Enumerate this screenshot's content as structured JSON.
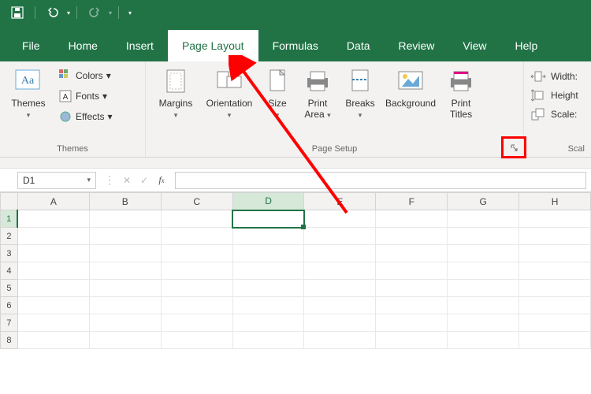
{
  "qat": {
    "save": "save",
    "undo": "undo",
    "redo": "redo"
  },
  "tabs": [
    "File",
    "Home",
    "Insert",
    "Page Layout",
    "Formulas",
    "Data",
    "Review",
    "View",
    "Help"
  ],
  "active_tab_index": 3,
  "themes_group": {
    "label": "Themes",
    "themes_btn": "Themes",
    "colors": "Colors",
    "fonts": "Fonts",
    "effects": "Effects"
  },
  "pagesetup_group": {
    "label": "Page Setup",
    "margins": "Margins",
    "orientation": "Orientation",
    "size": "Size",
    "print_area": "Print\nArea",
    "breaks": "Breaks",
    "background": "Background",
    "print_titles": "Print\nTitles"
  },
  "scale_group": {
    "label": "Scal",
    "width": "Width:",
    "height": "Height",
    "scale": "Scale:"
  },
  "namebox_value": "D1",
  "columns": [
    "A",
    "B",
    "C",
    "D",
    "E",
    "F",
    "G",
    "H"
  ],
  "rows": [
    "1",
    "2",
    "3",
    "4",
    "5",
    "6",
    "7",
    "8"
  ],
  "active_cell": {
    "row": 0,
    "col": 3
  }
}
